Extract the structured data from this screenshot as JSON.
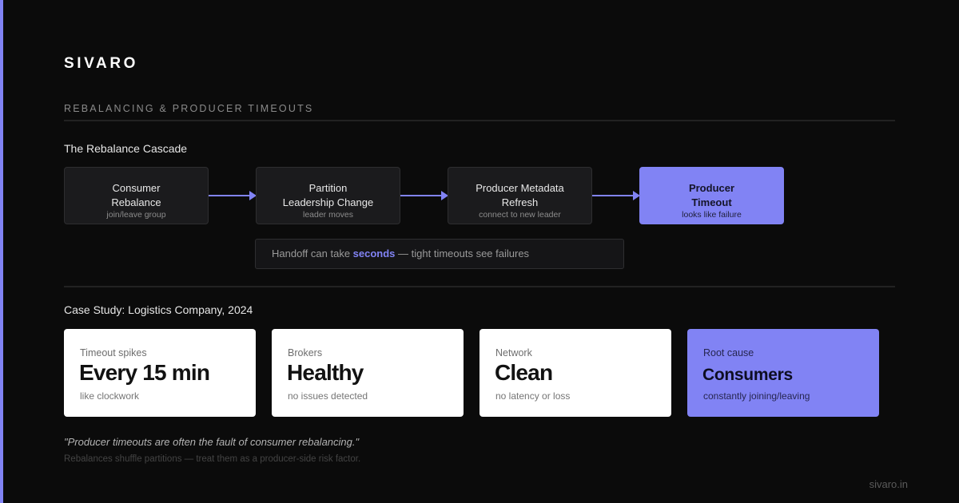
{
  "brand": "SIVARO",
  "section_title": "REBALANCING & PRODUCER TIMEOUTS",
  "cascade": {
    "title": "The Rebalance Cascade",
    "steps": [
      {
        "line1": "Consumer",
        "line2": "Rebalance",
        "sub": "join/leave group"
      },
      {
        "line1": "Partition",
        "line2": "Leadership Change",
        "sub": "leader moves"
      },
      {
        "line1": "Producer Metadata",
        "line2": "Refresh",
        "sub": "connect to new leader"
      },
      {
        "line1": "Producer",
        "line2": "Timeout",
        "sub": "looks like failure"
      }
    ],
    "note": {
      "before": "Handoff can take ",
      "highlight": "seconds",
      "after": " — tight timeouts see failures"
    }
  },
  "case_study": {
    "title": "Case Study: Logistics Company, 2024",
    "cards": [
      {
        "label": "Timeout spikes",
        "value": "Every 15 min",
        "desc": "like clockwork"
      },
      {
        "label": "Brokers",
        "value": "Healthy",
        "desc": "no issues detected"
      },
      {
        "label": "Network",
        "value": "Clean",
        "desc": "no latency or loss"
      },
      {
        "label": "Root cause",
        "value": "Consumers",
        "desc": "constantly joining/leaving"
      }
    ]
  },
  "quote": "\"Producer timeouts are often the fault of consumer rebalancing.\"",
  "footnote": "Rebalances shuffle partitions — treat them as a producer-side risk factor.",
  "site": "sivaro.in",
  "colors": {
    "accent": "#8183f4",
    "background": "#0b0b0b"
  }
}
